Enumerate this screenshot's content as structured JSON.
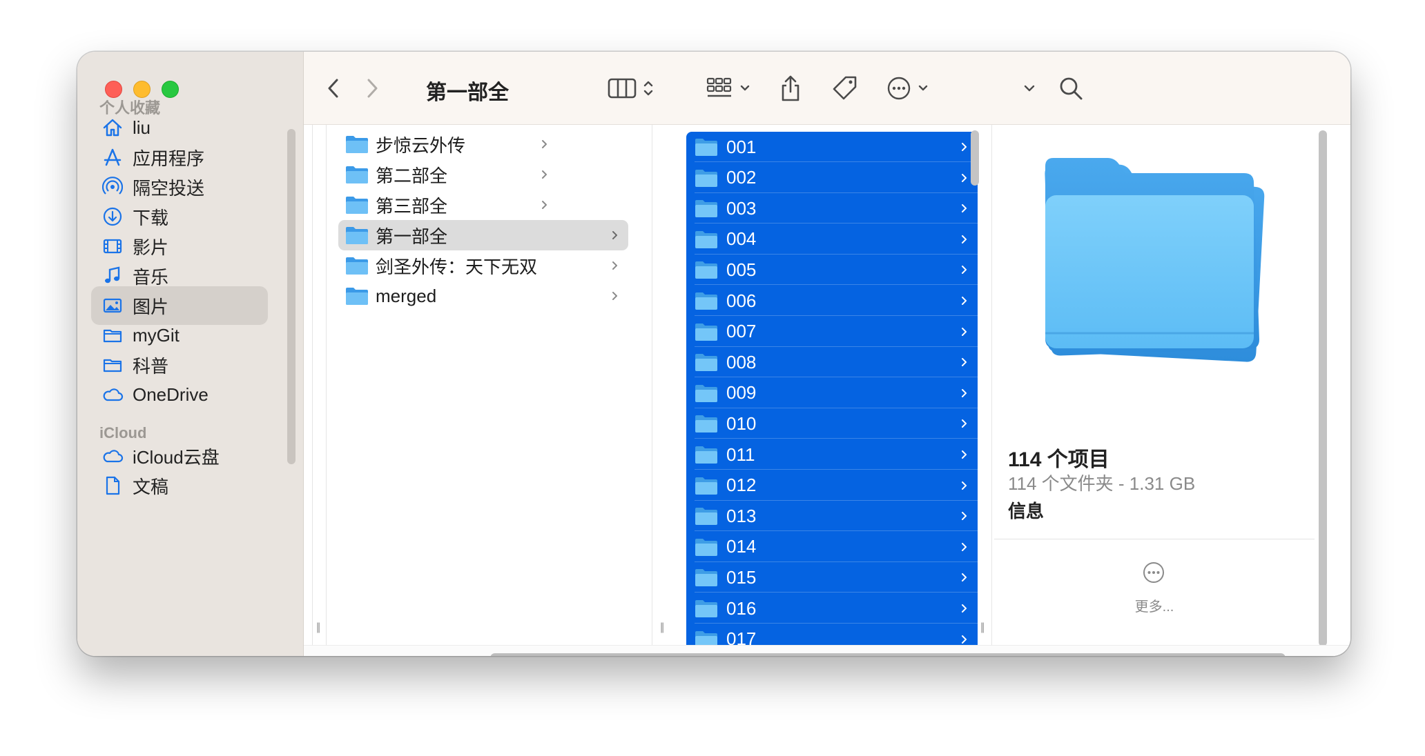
{
  "window": {
    "title": "第一部全"
  },
  "sidebar": {
    "favorites_header": "个人收藏",
    "favorites": [
      {
        "label": "liu",
        "icon": "house-icon"
      },
      {
        "label": "应用程序",
        "icon": "applications-icon"
      },
      {
        "label": "隔空投送",
        "icon": "airdrop-icon"
      },
      {
        "label": "下载",
        "icon": "download-icon"
      },
      {
        "label": "影片",
        "icon": "film-icon"
      },
      {
        "label": "音乐",
        "icon": "music-note-icon"
      },
      {
        "label": "图片",
        "icon": "photo-icon",
        "active": true
      },
      {
        "label": "myGit",
        "icon": "folder-icon"
      },
      {
        "label": "科普",
        "icon": "folder-icon"
      },
      {
        "label": "OneDrive",
        "icon": "cloud-icon"
      }
    ],
    "icloud_header": "iCloud",
    "icloud": [
      {
        "label": "iCloud云盘",
        "icon": "icloud-icon"
      },
      {
        "label": "文稿",
        "icon": "document-icon"
      }
    ]
  },
  "toolbar": {
    "back": "back-icon",
    "forward": "forward-icon",
    "view": "column-view-icon",
    "group": "grid-group-icon",
    "share": "share-icon",
    "tag": "tag-icon",
    "more": "more-icon",
    "dropdown": "chevron-down-icon",
    "search": "search-icon"
  },
  "columns": {
    "parent": [
      {
        "label": "步惊云外传"
      },
      {
        "label": "第二部全"
      },
      {
        "label": "第三部全"
      },
      {
        "label": "第一部全",
        "highlight": true
      },
      {
        "label": "剑圣外传：天下无双"
      },
      {
        "label": "merged"
      }
    ],
    "current": [
      "001",
      "002",
      "003",
      "004",
      "005",
      "006",
      "007",
      "008",
      "009",
      "010",
      "011",
      "012",
      "013",
      "014",
      "015",
      "016",
      "017"
    ]
  },
  "preview": {
    "title": "114 个项目",
    "subtitle": "114 个文件夹 - 1.31 GB",
    "info_label": "信息",
    "more_label": "更多..."
  },
  "colors": {
    "selection": "#0563e1",
    "folder": "#5ab3f0",
    "accent": "#1a73e8"
  }
}
